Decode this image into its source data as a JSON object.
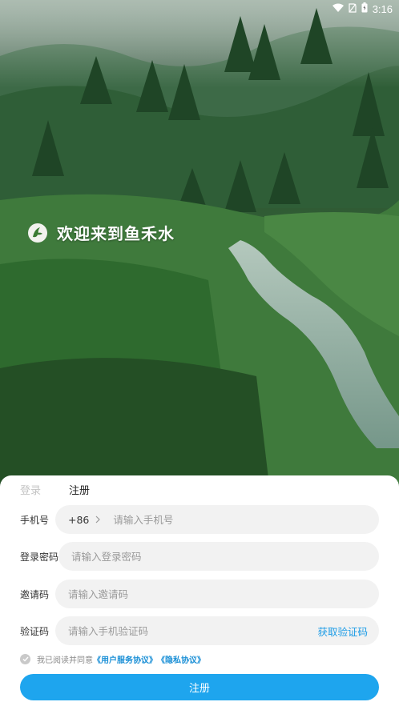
{
  "status_bar": {
    "time": "3:16",
    "icons": [
      "wifi-icon",
      "no-sim-icon",
      "battery-icon"
    ]
  },
  "welcome": {
    "logo_icon": "fish-logo-icon",
    "title": "欢迎来到鱼禾水"
  },
  "tabs": {
    "login": "登录",
    "register": "注册",
    "active": "register"
  },
  "form": {
    "phone": {
      "label": "手机号",
      "country_code": "+86",
      "placeholder": "请输入手机号",
      "value": ""
    },
    "password": {
      "label": "登录密码",
      "placeholder": "请输入登录密码",
      "value": ""
    },
    "invite": {
      "label": "邀请码",
      "placeholder": "请输入邀请码",
      "value": ""
    },
    "code": {
      "label": "验证码",
      "placeholder": "请输入手机验证码",
      "value": "",
      "get_code": "获取验证码"
    }
  },
  "agreement": {
    "prefix": "我已阅读并同意",
    "user_agreement": "《用户服务协议》",
    "privacy": "《隐私协议》",
    "checked": false
  },
  "submit_label": "注册",
  "colors": {
    "accent": "#1ea5ee",
    "link": "#1a8fd6",
    "field_bg": "#f2f2f2"
  }
}
